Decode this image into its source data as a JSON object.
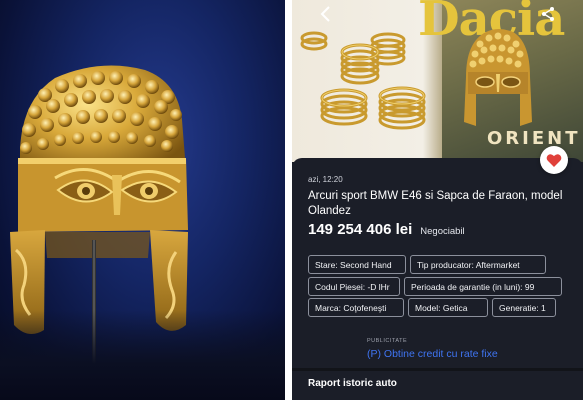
{
  "left_photo": {
    "image_name": "golden-helmet-museum-photo"
  },
  "listing": {
    "hero": {
      "magazine_title": "Dacia",
      "magazine_subtitle": "ORIENT",
      "back_icon": "chevron-left-icon",
      "share_icon": "share-icon"
    },
    "favorite_icon": "heart-icon",
    "date": "azi, 12:20",
    "title": "Arcuri sport BMW E46 si Sapca de Faraon, model Olandez",
    "price": "149 254 406 lei",
    "negotiable": "Negociabil",
    "attributes": [
      "Stare: Second Hand",
      "Tip producator: Aftermarket",
      "Codul Piesei: -D lHr",
      "Perioada de garantie (in luni): 99",
      "Marca: Coţofeneşti",
      "Model: Getica",
      "Generatie: 1"
    ],
    "promo": {
      "label": "PUBLICITATE",
      "link": "(P) Obtine credit cu rate fixe"
    },
    "section_title": "Raport istoric auto"
  },
  "colors": {
    "panel_bg": "#1b1e28",
    "link_blue": "#3f74f2",
    "favorite_red": "#e0403a",
    "gold": "#d9b24a"
  }
}
